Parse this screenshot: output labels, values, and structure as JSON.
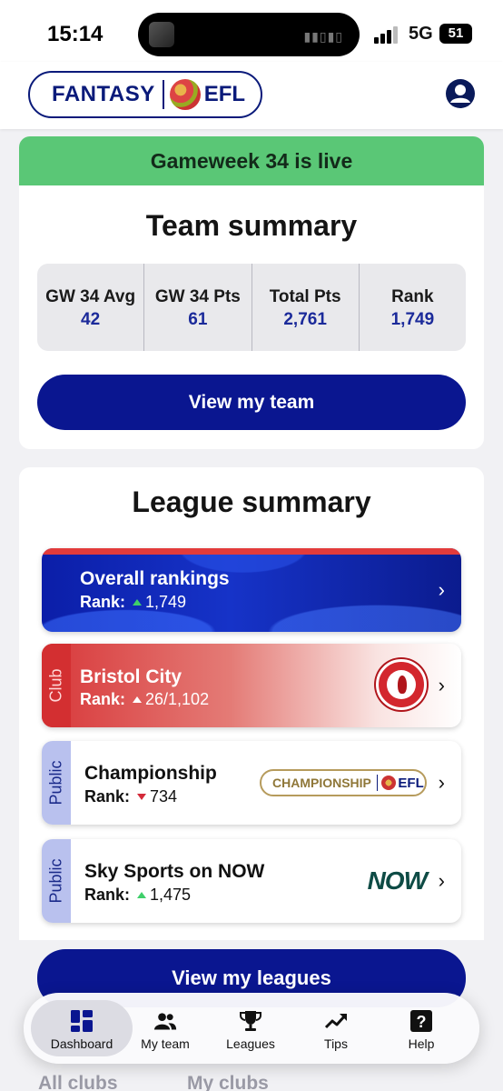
{
  "status_bar": {
    "time": "15:14",
    "network": "5G",
    "battery": "51"
  },
  "header": {
    "logo_left": "FANTASY",
    "logo_right": "EFL"
  },
  "banner": {
    "text": "Gameweek 34 is live"
  },
  "team_summary": {
    "title": "Team summary",
    "stats": [
      {
        "label": "GW 34 Avg",
        "value": "42"
      },
      {
        "label": "GW 34 Pts",
        "value": "61"
      },
      {
        "label": "Total Pts",
        "value": "2,761"
      },
      {
        "label": "Rank",
        "value": "1,749"
      }
    ],
    "button": "View my team"
  },
  "league_summary": {
    "title": "League summary",
    "leagues": [
      {
        "name": "Overall rankings",
        "rank_label": "Rank:",
        "rank": "1,749",
        "trend": "up"
      },
      {
        "tag": "Club",
        "name": "Bristol City",
        "rank_label": "Rank:",
        "rank": "26/1,102",
        "trend": "up"
      },
      {
        "tag": "Public",
        "name": "Championship",
        "rank_label": "Rank:",
        "rank": "734",
        "trend": "down",
        "badge_left": "CHAMPIONSHIP",
        "badge_right": "EFL"
      },
      {
        "tag": "Public",
        "name": "Sky Sports on NOW",
        "rank_label": "Rank:",
        "rank": "1,475",
        "trend": "up",
        "logo": "NOW"
      }
    ],
    "button": "View my leagues"
  },
  "behind": {
    "left": "All clubs",
    "right": "My clubs"
  },
  "nav": [
    {
      "label": "Dashboard",
      "icon": "dashboard-icon",
      "active": true
    },
    {
      "label": "My team",
      "icon": "people-icon"
    },
    {
      "label": "Leagues",
      "icon": "trophy-icon"
    },
    {
      "label": "Tips",
      "icon": "trend-icon"
    },
    {
      "label": "Help",
      "icon": "help-icon"
    }
  ],
  "colors": {
    "primary": "#0a1690",
    "live": "#5ac776",
    "club": "#d32f31",
    "public_tag": "#b9c1ee"
  }
}
